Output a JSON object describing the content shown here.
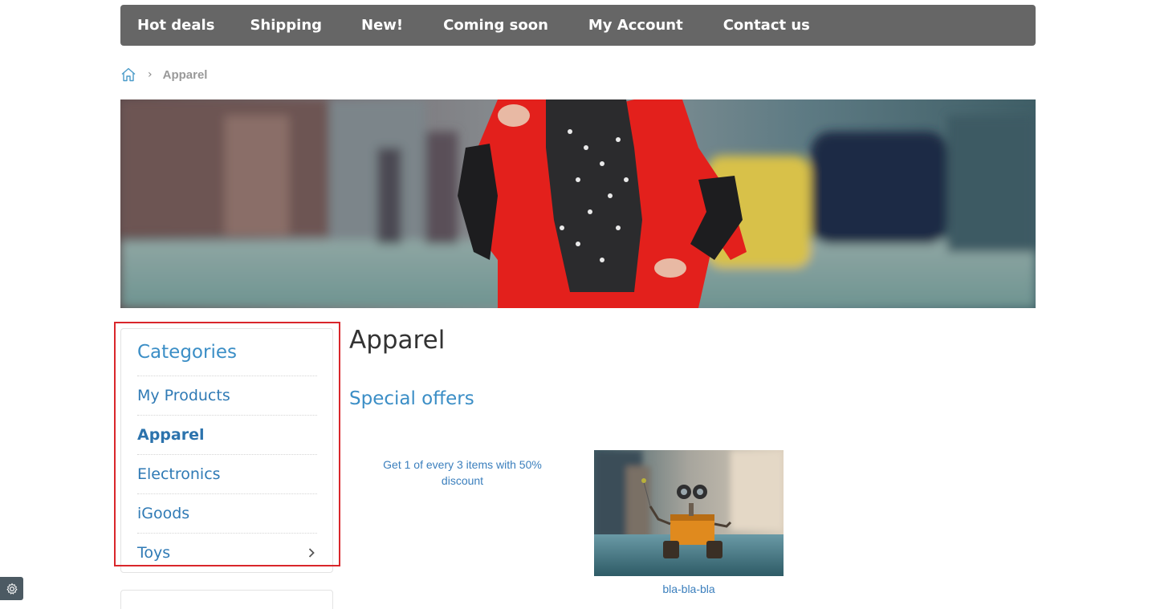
{
  "nav": {
    "items": [
      {
        "label": "Hot deals"
      },
      {
        "label": "Shipping"
      },
      {
        "label": "New!"
      },
      {
        "label": "Coming soon"
      },
      {
        "label": "My Account"
      },
      {
        "label": "Contact us"
      }
    ]
  },
  "breadcrumb": {
    "home_icon": "home-icon",
    "separator": "›",
    "current": "Apparel"
  },
  "sidebar": {
    "title": "Categories",
    "items": [
      {
        "label": "My Products",
        "active": false
      },
      {
        "label": "Apparel",
        "active": true
      },
      {
        "label": "Electronics",
        "active": false
      },
      {
        "label": "iGoods",
        "active": false
      },
      {
        "label": "Toys",
        "active": false,
        "has_children": true
      }
    ],
    "highlight_color": "#d9262b"
  },
  "main": {
    "title": "Apparel",
    "special_offers_title": "Special offers",
    "offers": [
      {
        "text": "Get 1 of every 3 items with 50% discount"
      },
      {
        "caption": "bla-bla-bla"
      }
    ]
  },
  "colors": {
    "nav_bg": "#666666",
    "link": "#3b8ec6"
  },
  "settings": {
    "icon": "gear-icon"
  }
}
